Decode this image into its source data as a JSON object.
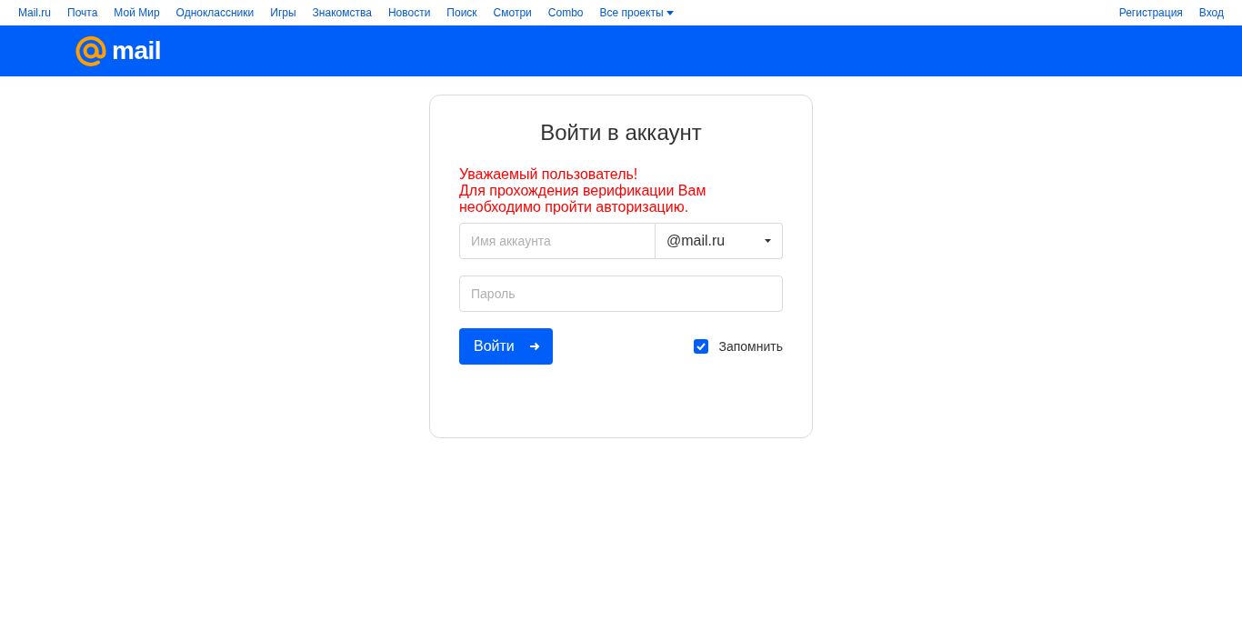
{
  "top_nav": {
    "links": [
      "Mail.ru",
      "Почта",
      "Мой Мир",
      "Одноклассники",
      "Игры",
      "Знакомства",
      "Новости",
      "Поиск",
      "Смотри",
      "Combo"
    ],
    "projects_menu": "Все проекты",
    "right_links": [
      "Регистрация",
      "Вход"
    ]
  },
  "header": {
    "logo_text": "mail"
  },
  "login_card": {
    "title": "Войти в аккаунт",
    "notice": [
      "Уважаемый пользователь!",
      "Для прохождения верификации Вам",
      "необходимо пройти авторизацию."
    ],
    "account_field": {
      "placeholder": "Имя аккаунта"
    },
    "domain_select": {
      "value": "@mail.ru"
    },
    "password_field": {
      "placeholder": "Пароль"
    },
    "submit_button": "Войти",
    "remember": {
      "label": "Запомнить",
      "checked": true
    }
  }
}
